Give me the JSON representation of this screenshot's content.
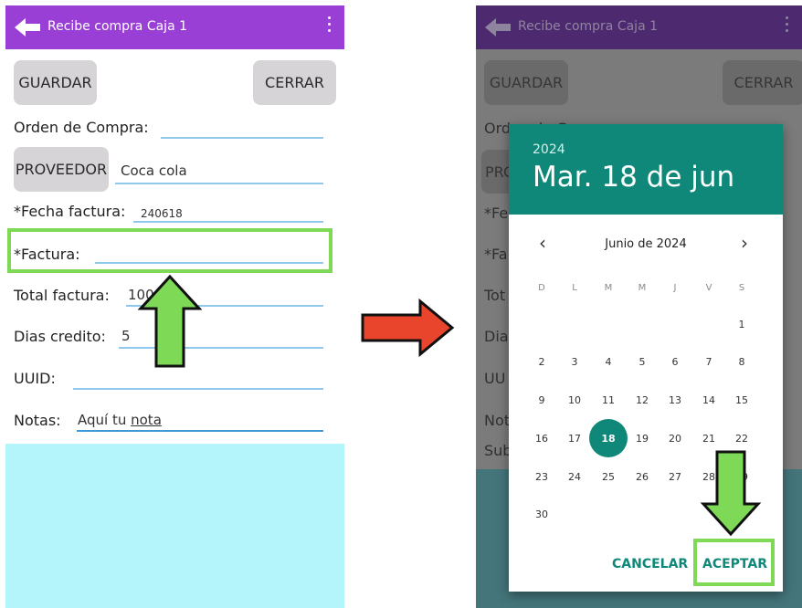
{
  "left_screen": {
    "app_title": "Recibe compra Caja 1",
    "buttons": {
      "save": "GUARDAR",
      "close": "CERRAR",
      "supplier": "PROVEEDOR"
    },
    "fields": {
      "purchase_order_label": "Orden de Compra:",
      "supplier_value": "Coca cola",
      "invoice_date_label": "*Fecha factura:",
      "invoice_date_value": "240618",
      "invoice_label": "*Factura:",
      "invoice_total_label": "Total factura:",
      "invoice_total_value": "100",
      "credit_days_label": "Dias credito:",
      "credit_days_value": "5",
      "uuid_label": "UUID:",
      "notes_label": "Notas:",
      "notes_value_prefix": "Aquí tu ",
      "notes_value_underlined": "nota"
    }
  },
  "right_screen": {
    "app_title": "Recibe compra Caja 1",
    "background": {
      "save": "GUARDAR",
      "close": "CERRAR",
      "partials": [
        "Orden de Compra:",
        "PRC",
        "*Fe",
        "*Fa",
        "Tot",
        "Dia",
        "UU",
        "Not",
        "Sub"
      ]
    },
    "date_picker": {
      "year": "2024",
      "selected_date": "Mar. 18 de jun",
      "month_label": "Junio de 2024",
      "prev": "‹",
      "next": "›",
      "weekdays": [
        "D",
        "L",
        "M",
        "M",
        "J",
        "V",
        "S"
      ],
      "weeks": [
        [
          "",
          "",
          "",
          "",
          "",
          "",
          "1"
        ],
        [
          "2",
          "3",
          "4",
          "5",
          "6",
          "7",
          "8"
        ],
        [
          "9",
          "10",
          "11",
          "12",
          "13",
          "14",
          "15"
        ],
        [
          "16",
          "17",
          "18",
          "19",
          "20",
          "21",
          "22"
        ],
        [
          "23",
          "24",
          "25",
          "26",
          "27",
          "28",
          "29"
        ],
        [
          "30",
          "",
          "",
          "",
          "",
          "",
          ""
        ]
      ],
      "selected_day": "18",
      "cancel": "CANCELAR",
      "accept": "ACEPTAR"
    }
  },
  "colors": {
    "app_bar": "#9a3fd6",
    "highlight": "#7ed957",
    "picker_header": "#0f887a",
    "transition_arrow": "#e8452c"
  }
}
